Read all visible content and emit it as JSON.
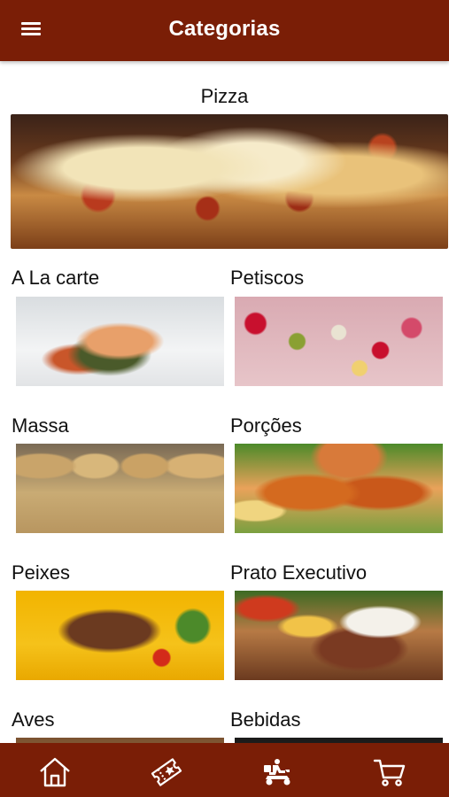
{
  "header": {
    "title": "Categorias",
    "menu_icon": "menu-icon"
  },
  "featured": {
    "label": "Pizza"
  },
  "categories": [
    {
      "label": "A La carte"
    },
    {
      "label": "Petiscos"
    },
    {
      "label": "Massa"
    },
    {
      "label": "Porções"
    },
    {
      "label": "Peixes"
    },
    {
      "label": "Prato Executivo"
    },
    {
      "label": "Aves"
    },
    {
      "label": "Bebidas"
    }
  ],
  "bottom_nav": [
    {
      "icon": "home-icon"
    },
    {
      "icon": "coupon-icon"
    },
    {
      "icon": "delivery-scooter-icon"
    },
    {
      "icon": "cart-icon"
    }
  ],
  "colors": {
    "bar": "#7a1e06",
    "text": "#111111",
    "background": "#ffffff"
  }
}
